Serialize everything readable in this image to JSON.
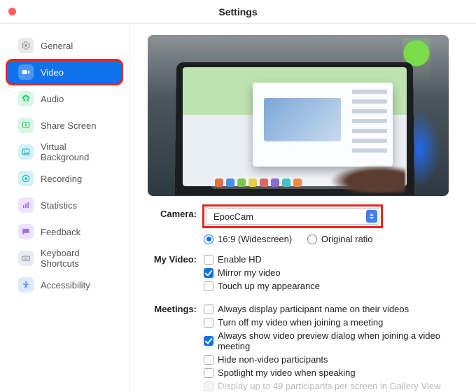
{
  "window": {
    "title": "Settings"
  },
  "sidebar": {
    "items": [
      {
        "label": "General",
        "icon": "gear-icon",
        "color": "#bfbfbf"
      },
      {
        "label": "Video",
        "icon": "video-icon",
        "color": "#0e72ec",
        "active": true
      },
      {
        "label": "Audio",
        "icon": "audio-icon",
        "color": "#27c56b"
      },
      {
        "label": "Share Screen",
        "icon": "share-icon",
        "color": "#27c56b"
      },
      {
        "label": "Virtual Background",
        "icon": "background-icon",
        "color": "#1fb6c7"
      },
      {
        "label": "Recording",
        "icon": "recording-icon",
        "color": "#1fb6c7"
      },
      {
        "label": "Statistics",
        "icon": "stats-icon",
        "color": "#9a6ff0"
      },
      {
        "label": "Feedback",
        "icon": "feedback-icon",
        "color": "#9a6ff0"
      },
      {
        "label": "Keyboard Shortcuts",
        "icon": "keyboard-icon",
        "color": "#8a97a6"
      },
      {
        "label": "Accessibility",
        "icon": "accessibility-icon",
        "color": "#4f8ef7"
      }
    ]
  },
  "camera": {
    "label": "Camera:",
    "selected": "EpocCam",
    "ratio_options": {
      "widescreen": "16:9 (Widescreen)",
      "original": "Original ratio"
    },
    "selected_ratio": "widescreen"
  },
  "my_video": {
    "label": "My Video:",
    "options": [
      {
        "key": "enable_hd",
        "label": "Enable HD",
        "checked": false
      },
      {
        "key": "mirror",
        "label": "Mirror my video",
        "checked": true
      },
      {
        "key": "touch_up",
        "label": "Touch up my appearance",
        "checked": false
      }
    ]
  },
  "meetings": {
    "label": "Meetings:",
    "options": [
      {
        "key": "show_names",
        "label": "Always display participant name on their videos",
        "checked": false
      },
      {
        "key": "off_on_join",
        "label": "Turn off my video when joining a meeting",
        "checked": false
      },
      {
        "key": "preview_dialog",
        "label": "Always show video preview dialog when joining a video meeting",
        "checked": true
      },
      {
        "key": "hide_nonvideo",
        "label": "Hide non-video participants",
        "checked": false
      },
      {
        "key": "spotlight",
        "label": "Spotlight my video when speaking",
        "checked": false
      },
      {
        "key": "gallery49",
        "label": "Display up to 49 participants per screen in Gallery View",
        "checked": false,
        "disabled": true
      }
    ]
  }
}
